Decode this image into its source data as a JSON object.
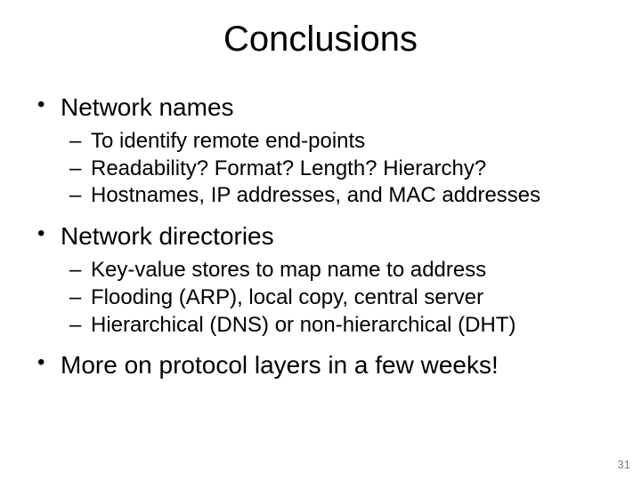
{
  "slide": {
    "title": "Conclusions",
    "bullets": [
      {
        "text": "Network names",
        "subs": [
          "To identify remote end-points",
          "Readability? Format? Length? Hierarchy?",
          "Hostnames, IP addresses, and MAC addresses"
        ]
      },
      {
        "text": "Network directories",
        "subs": [
          "Key-value stores to map name to address",
          "Flooding (ARP), local copy, central server",
          "Hierarchical (DNS) or non-hierarchical (DHT)"
        ]
      },
      {
        "text": "More on protocol layers in a few weeks!",
        "subs": []
      }
    ],
    "page_number": "31"
  }
}
